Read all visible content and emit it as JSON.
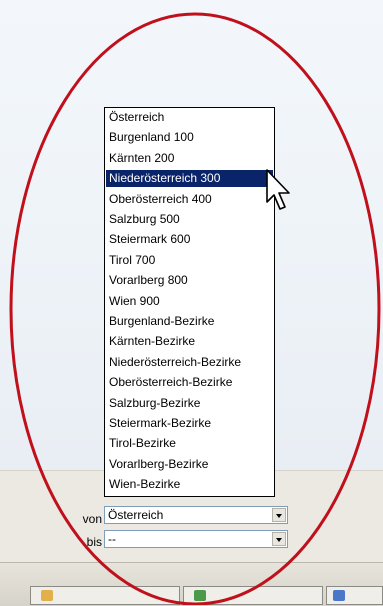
{
  "dropdown": {
    "selected_index": 3,
    "items": [
      "Österreich",
      "Burgenland 100",
      "Kärnten 200",
      "Niederösterreich 300",
      "Oberösterreich 400",
      "Salzburg 500",
      "Steiermark 600",
      "Tirol 700",
      "Vorarlberg 800",
      "Wien 900",
      "Burgenland-Bezirke",
      "Kärnten-Bezirke",
      "Niederösterreich-Bezirke",
      "Oberösterreich-Bezirke",
      "Salzburg-Bezirke",
      "Steiermark-Bezirke",
      "Tirol-Bezirke",
      "Vorarlberg-Bezirke",
      "Wien-Bezirke"
    ]
  },
  "form": {
    "von_label": "von",
    "von_value": "Österreich",
    "bis_label": "bis",
    "bis_value": "--"
  },
  "colors": {
    "highlight": "#0a246a",
    "annotation_oval": "#c0101c"
  },
  "icons": [
    "mouse-pointer-icon",
    "dropdown-arrow-icon"
  ]
}
